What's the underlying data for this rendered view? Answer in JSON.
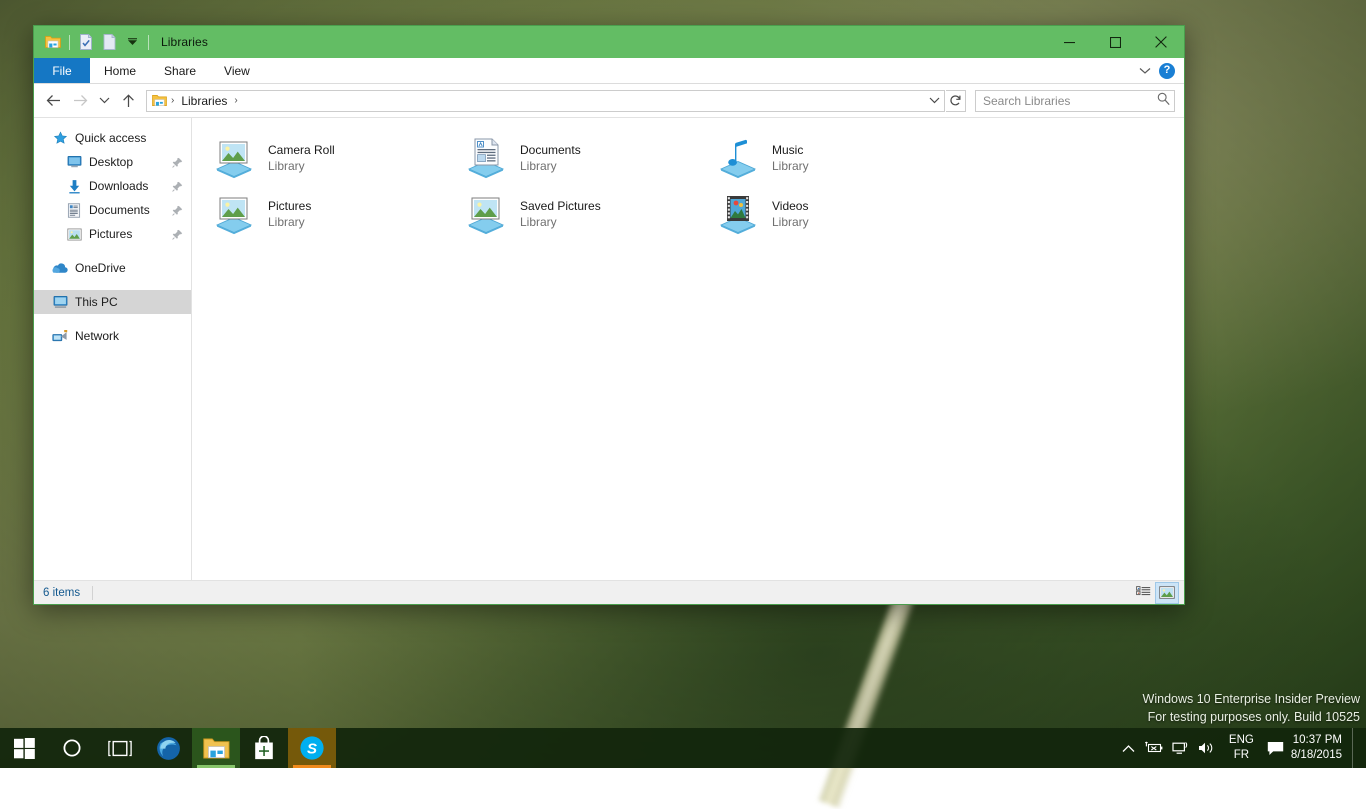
{
  "desktop": {
    "watermark_line1": "Windows 10 Enterprise Insider Preview",
    "watermark_line2": "For testing purposes only. Build 10525"
  },
  "window": {
    "title": "Libraries",
    "quick_access_toolbar": [
      {
        "name": "explorer-icon",
        "label": "File Explorer"
      },
      {
        "name": "properties-icon",
        "label": "Properties"
      },
      {
        "name": "new-folder-icon",
        "label": "New folder"
      },
      {
        "name": "customize-qat-icon",
        "label": "Customize Quick Access Toolbar"
      }
    ],
    "controls": {
      "minimize": "─",
      "maximize": "☐",
      "close": "✕"
    }
  },
  "ribbon": {
    "file_tab": "File",
    "tabs": [
      "Home",
      "Share",
      "View"
    ],
    "expand_label": "⌄",
    "help_label": "?"
  },
  "address": {
    "back_label": "←",
    "forward_label": "→",
    "recent_label": "⌄",
    "up_label": "↑",
    "breadcrumb": [
      "Libraries"
    ],
    "separator": "›",
    "dropdown_label": "⌄",
    "refresh_label": "↻"
  },
  "search": {
    "placeholder": "Search Libraries",
    "value": "",
    "icon": "search-icon"
  },
  "sidebar": {
    "items": [
      {
        "label": "Quick access",
        "icon": "star-icon",
        "level": 0,
        "pinned": false,
        "selected": false
      },
      {
        "label": "Desktop",
        "icon": "desktop-icon",
        "level": 1,
        "pinned": true,
        "selected": false
      },
      {
        "label": "Downloads",
        "icon": "downloads-icon",
        "level": 1,
        "pinned": true,
        "selected": false
      },
      {
        "label": "Documents",
        "icon": "documents-icon",
        "level": 1,
        "pinned": true,
        "selected": false
      },
      {
        "label": "Pictures",
        "icon": "pictures-icon",
        "level": 1,
        "pinned": true,
        "selected": false
      },
      {
        "label": "OneDrive",
        "icon": "onedrive-icon",
        "level": 0,
        "pinned": false,
        "selected": false
      },
      {
        "label": "This PC",
        "icon": "thispc-icon",
        "level": 0,
        "pinned": false,
        "selected": true
      },
      {
        "label": "Network",
        "icon": "network-icon",
        "level": 0,
        "pinned": false,
        "selected": false
      }
    ]
  },
  "content": {
    "items": [
      {
        "name": "Camera Roll",
        "type": "Library",
        "icon": "library-pictures-icon"
      },
      {
        "name": "Documents",
        "type": "Library",
        "icon": "library-documents-icon"
      },
      {
        "name": "Music",
        "type": "Library",
        "icon": "library-music-icon"
      },
      {
        "name": "Pictures",
        "type": "Library",
        "icon": "library-pictures-icon"
      },
      {
        "name": "Saved Pictures",
        "type": "Library",
        "icon": "library-pictures-icon"
      },
      {
        "name": "Videos",
        "type": "Library",
        "icon": "library-videos-icon"
      }
    ]
  },
  "statusbar": {
    "item_count": "6 items",
    "views": [
      {
        "name": "details-view-button",
        "active": false
      },
      {
        "name": "large-icons-view-button",
        "active": true
      }
    ]
  },
  "taskbar": {
    "start": "start-button",
    "cortana": "cortana-search-button",
    "taskview": "task-view-button",
    "apps": [
      {
        "name": "edge-browser",
        "running": false
      },
      {
        "name": "file-explorer",
        "running": "green"
      },
      {
        "name": "microsoft-store",
        "running": false
      },
      {
        "name": "skype",
        "running": "orange"
      }
    ],
    "tray": {
      "show_hidden": "∧",
      "icons": [
        "battery-icon",
        "network-icon",
        "volume-icon",
        "action-center-icon"
      ],
      "language_line1": "ENG",
      "language_line2": "FR",
      "time": "10:37 PM",
      "date": "8/18/2015"
    }
  }
}
